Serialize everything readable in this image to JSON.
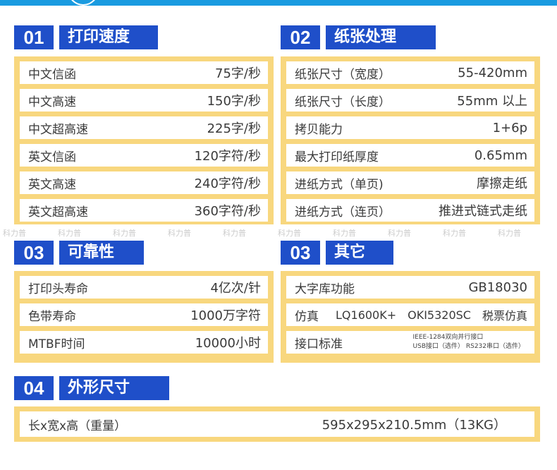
{
  "sections": {
    "speed": {
      "number": "01",
      "title": "打印速度",
      "rows": [
        {
          "label": "中文信函",
          "value": "75字/秒"
        },
        {
          "label": "中文高速",
          "value": "150字/秒"
        },
        {
          "label": "中文超高速",
          "value": "225字/秒"
        },
        {
          "label": "英文信函",
          "value": "120字符/秒"
        },
        {
          "label": "英文高速",
          "value": "240字符/秒"
        },
        {
          "label": "英文超高速",
          "value": "360字符/秒"
        }
      ]
    },
    "paper": {
      "number": "02",
      "title": "纸张处理",
      "rows": [
        {
          "label": "纸张尺寸（宽度）",
          "value": "55-420mm"
        },
        {
          "label": "纸张尺寸（长度）",
          "value": "55mm 以上"
        },
        {
          "label": "拷贝能力",
          "value": "1+6p"
        },
        {
          "label": "最大打印纸厚度",
          "value": "0.65mm"
        },
        {
          "label": "进纸方式（单页)",
          "value": "摩擦走纸"
        },
        {
          "label": "进纸方式（连页）",
          "value": "推进式链式走纸"
        }
      ]
    },
    "reliability": {
      "number": "03",
      "title": "可靠性",
      "rows": [
        {
          "label": "打印头寿命",
          "value": "4亿次/针"
        },
        {
          "label": "色带寿命",
          "value": "1000万字符"
        },
        {
          "label": "MTBF时间",
          "value": "10000小时"
        }
      ]
    },
    "other": {
      "number": "03",
      "title": "其它",
      "font_label": "大字库功能",
      "font_value": "GB18030",
      "emu_label": "仿真",
      "emu_values": [
        "LQ1600K+",
        "OKI5320SC",
        "税票仿真"
      ],
      "iface_label": "接口标准",
      "iface_line1": "IEEE-1284双向并行接口",
      "iface_line2": "USB接口（选件） RS232串口（选件）"
    },
    "size": {
      "number": "04",
      "title": "外形尺寸",
      "label": "长x宽x高（重量）",
      "value": "595x295x210.5mm（13KG）"
    }
  },
  "watermark_text": "科力普",
  "colors": {
    "header_blue": "#1f4fc9",
    "panel_yellow": "#f8d77e",
    "top_band": "#1a9be0"
  }
}
